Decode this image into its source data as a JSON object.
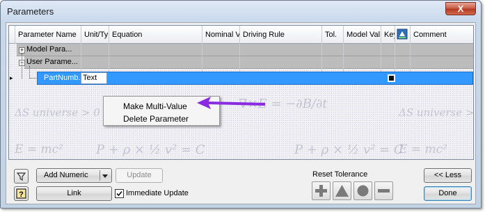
{
  "window": {
    "title": "Parameters",
    "close_glyph": "X"
  },
  "columns": [
    "Parameter Name",
    "Unit/Ty",
    "Equation",
    "Nominal V",
    "Driving Rule",
    "Tol.",
    "Model Val",
    "Key",
    "Comment"
  ],
  "tree": [
    {
      "expander": "+",
      "label": "Model Para..."
    },
    {
      "expander": "−",
      "label": "User Parame..."
    }
  ],
  "selected_row": {
    "indicator": "▸",
    "name": "PartNumb...",
    "unit": "Text"
  },
  "context_menu": {
    "items": [
      "Make Multi-Value",
      "Delete Parameter"
    ]
  },
  "watermark_formulas": [
    "∇×E = −∂B/∂t",
    "ΔS universe > 0",
    "E = mc²",
    "P + ρ × ½ v² = C"
  ],
  "bottom": {
    "add_numeric": "Add Numeric",
    "update": "Update",
    "link": "Link",
    "immediate_update": "Immediate Update",
    "immediate_update_checked": true,
    "reset_tolerance": "Reset Tolerance",
    "less": "<< Less",
    "done": "Done"
  },
  "icons": [
    "filter-icon",
    "help-icon",
    "dropdown-arrow-icon",
    "plus-icon",
    "triangle-icon",
    "circle-icon",
    "minus-icon",
    "comment-icon",
    "expand-icon",
    "collapse-icon"
  ],
  "colors": {
    "selection": "#3399ff",
    "arrow": "#8a2be2",
    "tree_row": "#bcbcbc"
  }
}
